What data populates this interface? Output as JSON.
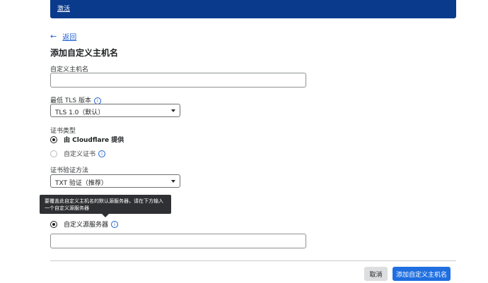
{
  "banner": {
    "link": "激活"
  },
  "nav": {
    "back_arrow": "←",
    "back_label": "返回"
  },
  "page": {
    "title": "添加自定义主机名"
  },
  "form": {
    "hostname": {
      "label": "自定义主机名",
      "value": ""
    },
    "tls": {
      "label": "最低 TLS 版本",
      "value": "TLS 1.0（默认）"
    },
    "cert_type": {
      "label": "证书类型",
      "options": [
        {
          "label": "由 Cloudflare 提供",
          "checked": true
        },
        {
          "label": "自定义证书",
          "checked": false
        }
      ]
    },
    "verify": {
      "label": "证书验证方法",
      "value": "TXT 验证（推荐）"
    },
    "tooltip": "要覆盖此自定义主机名的默认源服务器，请在下方输入一个自定义源服务器",
    "origin": {
      "label": "自定义源服务器",
      "value": ""
    }
  },
  "info_glyph": "i",
  "actions": {
    "cancel": "取消",
    "submit": "添加自定义主机名"
  },
  "colors": {
    "banner": "#0a3a8c",
    "primary": "#1f6fe0",
    "link": "#1f5fd1"
  }
}
